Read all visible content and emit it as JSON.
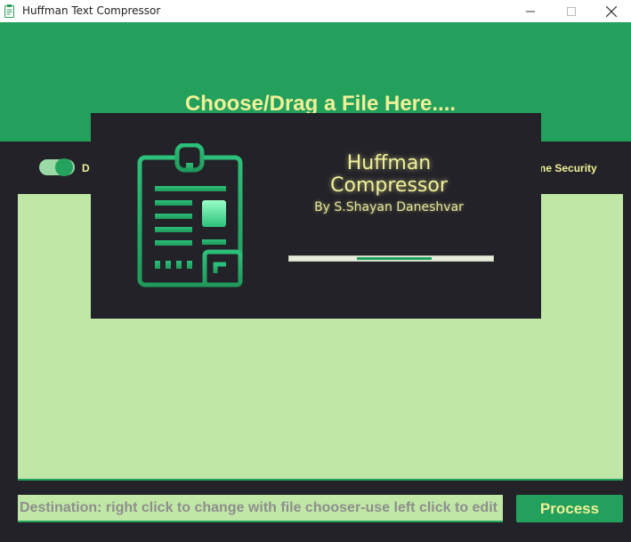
{
  "window": {
    "title": "Huffman Text Compressor"
  },
  "header": {
    "title": "Choose/Drag a File Here...."
  },
  "controls": {
    "toggle_label": "D",
    "toggle_on": true,
    "security_label": "eme Security"
  },
  "destination": {
    "placeholder": "Destination: right click to change with file chooser-use left click to edit"
  },
  "process_button": {
    "label": "Process"
  },
  "splash": {
    "title": "Huffman Compressor",
    "author": "By S.Shayan Daneshvar",
    "progress": {
      "start": 0.33,
      "end": 0.7
    }
  },
  "colors": {
    "accent": "#22a05c",
    "background": "#232228",
    "text_area": "#c0e7a5",
    "title_text": "#f0f098"
  },
  "icons": [
    "app-icon",
    "minimize-icon",
    "maximize-icon",
    "close-icon",
    "document-icon"
  ]
}
